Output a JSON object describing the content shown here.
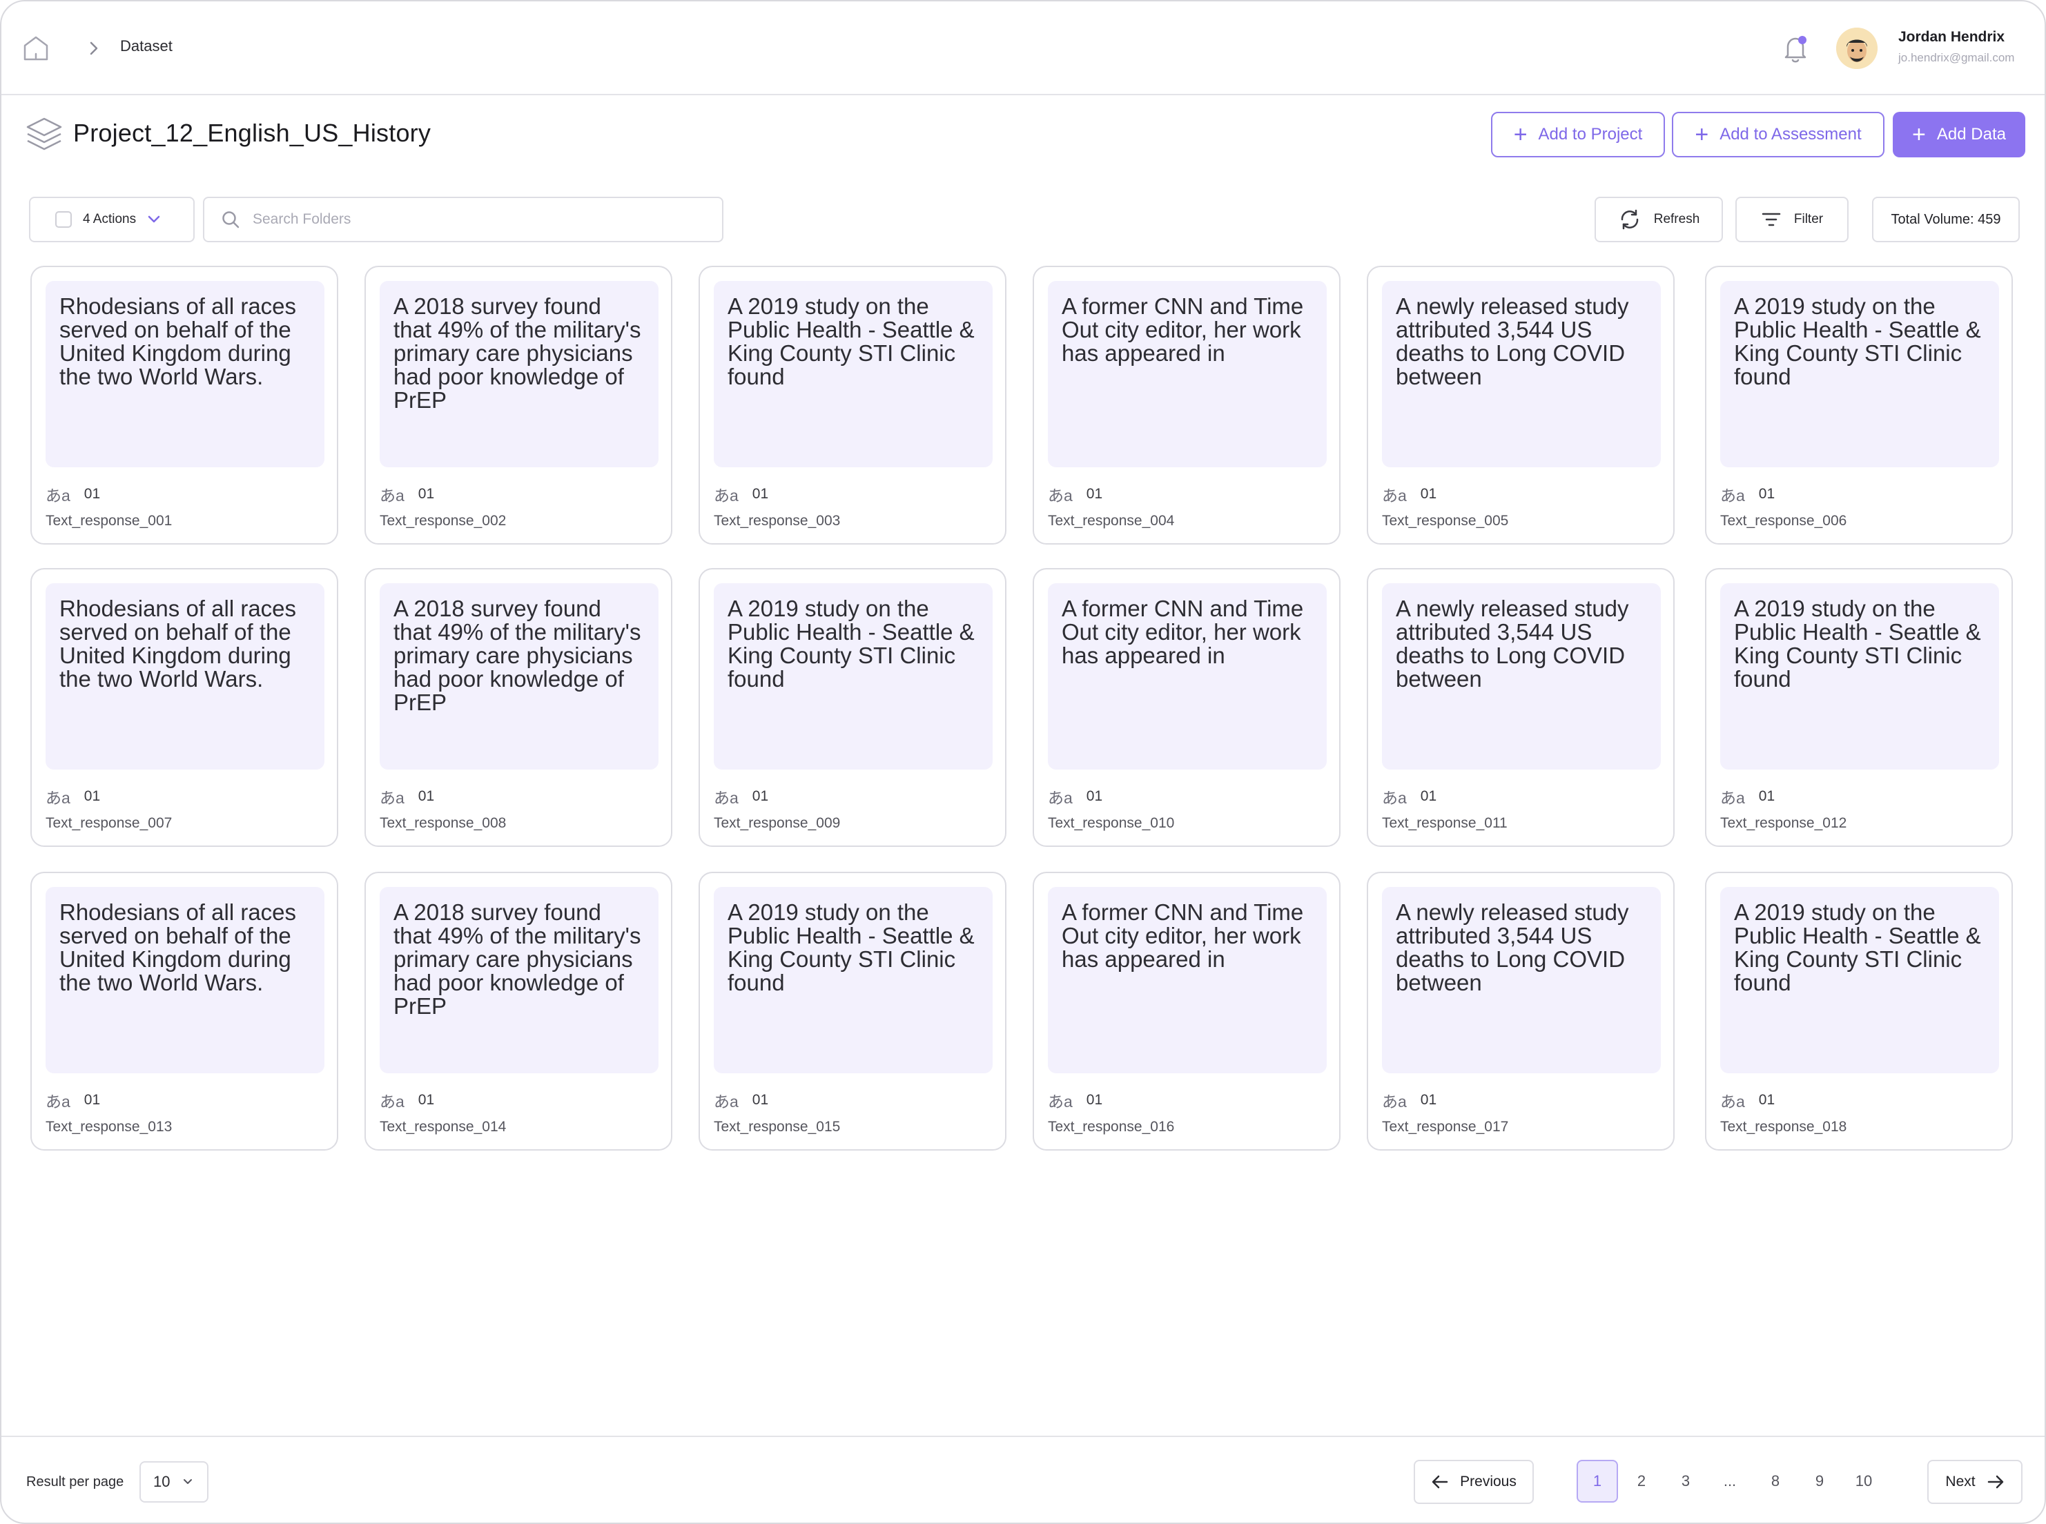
{
  "breadcrumb": {
    "current": "Dataset"
  },
  "user": {
    "name": "Jordan Hendrix",
    "email": "jo.hendrix@gmail.com"
  },
  "project": {
    "title": "Project_12_English_US_History"
  },
  "header_buttons": {
    "add_to_project": "Add to Project",
    "add_to_assessment": "Add to Assessment",
    "add_data": "Add Data"
  },
  "toolbar": {
    "actions_label": "4 Actions",
    "search_placeholder": "Search Folders",
    "refresh": "Refresh",
    "filter": "Filter",
    "total_volume": "Total Volume: 459"
  },
  "cards": [
    {
      "text": "Rhodesians of all races served on behalf of the United Kingdom during the two World Wars.",
      "count": "01",
      "name": "Text_response_001"
    },
    {
      "text": "A 2018 survey found that 49% of the military's primary care physicians had poor knowledge of PrEP",
      "count": "01",
      "name": "Text_response_002"
    },
    {
      "text": "A 2019 study on the Public Health - Seattle & King County STI Clinic found",
      "count": "01",
      "name": "Text_response_003"
    },
    {
      "text": "A former CNN and Time Out city editor, her work has appeared in",
      "count": "01",
      "name": "Text_response_004"
    },
    {
      "text": "A newly released study attributed 3,544 US deaths to Long COVID between",
      "count": "01",
      "name": "Text_response_005"
    },
    {
      "text": "A 2019 study on the Public Health - Seattle & King County STI Clinic found",
      "count": "01",
      "name": "Text_response_006"
    },
    {
      "text": "Rhodesians of all races served on behalf of the United Kingdom during the two World Wars.",
      "count": "01",
      "name": "Text_response_007"
    },
    {
      "text": "A 2018 survey found that 49% of the military's primary care physicians had poor knowledge of PrEP",
      "count": "01",
      "name": "Text_response_008"
    },
    {
      "text": "A 2019 study on the Public Health - Seattle & King County STI Clinic found",
      "count": "01",
      "name": "Text_response_009"
    },
    {
      "text": "A former CNN and Time Out city editor, her work has appeared in",
      "count": "01",
      "name": "Text_response_010"
    },
    {
      "text": "A newly released study attributed 3,544 US deaths to Long COVID between",
      "count": "01",
      "name": "Text_response_011"
    },
    {
      "text": "A 2019 study on the Public Health - Seattle & King County STI Clinic found",
      "count": "01",
      "name": "Text_response_012"
    },
    {
      "text": "Rhodesians of all races served on behalf of the United Kingdom during the two World Wars.",
      "count": "01",
      "name": "Text_response_013"
    },
    {
      "text": "A 2018 survey found that 49% of the military's primary care physicians had poor knowledge of PrEP",
      "count": "01",
      "name": "Text_response_014"
    },
    {
      "text": "A 2019 study on the Public Health - Seattle & King County STI Clinic found",
      "count": "01",
      "name": "Text_response_015"
    },
    {
      "text": "A former CNN and Time Out city editor, her work has appeared in",
      "count": "01",
      "name": "Text_response_016"
    },
    {
      "text": "A newly released study attributed 3,544 US deaths to Long COVID between",
      "count": "01",
      "name": "Text_response_017"
    },
    {
      "text": "A 2019 study on the Public Health - Seattle & King County STI Clinic found",
      "count": "01",
      "name": "Text_response_018"
    }
  ],
  "pagination": {
    "results_per_page_label": "Result per page",
    "results_per_page": "10",
    "previous": "Previous",
    "next": "Next",
    "pages": [
      "1",
      "2",
      "3",
      "...",
      "8",
      "9",
      "10"
    ],
    "current": "1"
  },
  "colors": {
    "accent": "#8c74f0",
    "card_preview_bg": "#f3f1fd"
  }
}
